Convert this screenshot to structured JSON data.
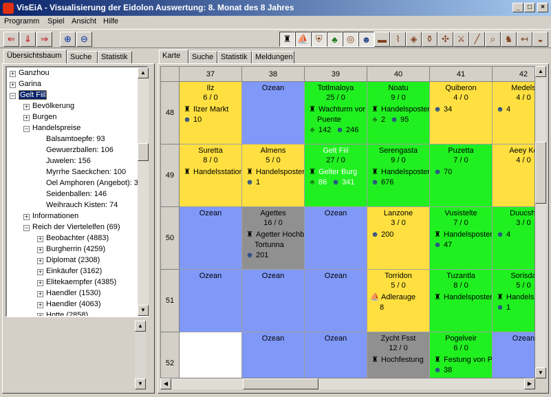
{
  "window": {
    "title": "VisEiA - Visualisierung der Eidolon Auswertung: 8. Monat des 8 Jahres",
    "minimize": "_",
    "maximize": "□",
    "close": "×"
  },
  "menu": [
    "Programm",
    "Spiel",
    "Ansicht",
    "Hilfe"
  ],
  "left_tabs": [
    "Übersichtsbaum",
    "Suche",
    "Statistik"
  ],
  "right_tabs": [
    "Karte",
    "Suche",
    "Statistik",
    "Meldungen"
  ],
  "tree": [
    {
      "label": "Ganzhou",
      "level": 0,
      "box": "+"
    },
    {
      "label": "Garina",
      "level": 0,
      "box": "+"
    },
    {
      "label": "Gelt Fiil",
      "level": 0,
      "box": "−",
      "selected": true
    },
    {
      "label": "Bevölkerung",
      "level": 1,
      "box": "+"
    },
    {
      "label": "Burgen",
      "level": 1,
      "box": "+"
    },
    {
      "label": "Handelspreise",
      "level": 1,
      "box": "−"
    },
    {
      "label": "Balsamtoepfe: 93",
      "level": 2,
      "box": ""
    },
    {
      "label": "Gewuerzballen: 106",
      "level": 2,
      "box": ""
    },
    {
      "label": "Juwelen: 156",
      "level": 2,
      "box": ""
    },
    {
      "label": "Myrrhe Saeckchen: 100",
      "level": 2,
      "box": ""
    },
    {
      "label": "Oel Amphoren (Angebot): 3",
      "level": 2,
      "box": ""
    },
    {
      "label": "Seidenballen: 146",
      "level": 2,
      "box": ""
    },
    {
      "label": "Weihrauch Kisten: 74",
      "level": 2,
      "box": ""
    },
    {
      "label": "Informationen",
      "level": 1,
      "box": "+"
    },
    {
      "label": "Reich der Viertelelfen (69)",
      "level": 1,
      "box": "−"
    },
    {
      "label": "Beobachter (4883)",
      "level": 2,
      "box": "+"
    },
    {
      "label": "Burgherrin (4259)",
      "level": 2,
      "box": "+"
    },
    {
      "label": "Diplomat (2308)",
      "level": 2,
      "box": "+"
    },
    {
      "label": "Einkäufer (3162)",
      "level": 2,
      "box": "+"
    },
    {
      "label": "Elitekaempfer (4385)",
      "level": 2,
      "box": "+"
    },
    {
      "label": "Haendler (1530)",
      "level": 2,
      "box": "+"
    },
    {
      "label": "Haendler (4063)",
      "level": 2,
      "box": "+"
    },
    {
      "label": "Hotte (2858)",
      "level": 2,
      "box": "+"
    }
  ],
  "columns": [
    "37",
    "38",
    "39",
    "40",
    "41",
    "42"
  ],
  "rows": [
    "48",
    "49",
    "50",
    "51",
    "52"
  ],
  "colors": {
    "yellow": "#ffe040",
    "blue": "#8098f8",
    "green": "#20f020",
    "gray": "#909090",
    "white": "#ffffff",
    "selection": "#0a246a"
  },
  "cells": [
    [
      {
        "color": "yellow",
        "name": "Ilz",
        "stat": "6 / 0",
        "lines": [
          {
            "icon": "castle-icon",
            "text": "Ilzer Markt"
          },
          {
            "icon": "people-icon",
            "text": "10"
          }
        ]
      },
      {
        "color": "blue",
        "name": "Ozean",
        "stat": "",
        "lines": []
      },
      {
        "color": "green",
        "name": "Totlmaloya",
        "stat": "25 / 0",
        "lines": [
          {
            "icon": "castle-icon",
            "text": "Wachturm vor"
          },
          {
            "icon": "",
            "text": "Puente"
          },
          {
            "icon": "tree-icon",
            "text": "142"
          },
          {
            "icon": "people-icon",
            "text": "246"
          }
        ]
      },
      {
        "color": "green",
        "name": "Noatu",
        "stat": "9 / 0",
        "lines": [
          {
            "icon": "castle-icon",
            "text": "Handelsposter"
          },
          {
            "icon": "tree-icon",
            "text": "2"
          },
          {
            "icon": "people-icon",
            "text": "95"
          }
        ]
      },
      {
        "color": "yellow",
        "name": "Quiberon",
        "stat": "4 / 0",
        "lines": [
          {
            "icon": "people-icon",
            "text": "34"
          }
        ]
      },
      {
        "color": "yellow",
        "name": "Medels",
        "stat": "4 / 0",
        "lines": [
          {
            "icon": "people-icon",
            "text": "4"
          }
        ]
      }
    ],
    [
      {
        "color": "yellow",
        "name": "Suretta",
        "stat": "8 / 0",
        "lines": [
          {
            "icon": "castle-icon",
            "text": "Handelsstation"
          }
        ]
      },
      {
        "color": "yellow",
        "name": "Almens",
        "stat": "5 / 0",
        "lines": [
          {
            "icon": "castle-icon",
            "text": "Handelsposter"
          },
          {
            "icon": "people-icon",
            "text": "1"
          }
        ]
      },
      {
        "color": "green",
        "name": "Gelt Fiil",
        "stat": "27 / 0",
        "lines": [
          {
            "icon": "castle-icon",
            "text": "Gelter Burg"
          },
          {
            "icon": "tree-icon",
            "text": "86"
          },
          {
            "icon": "people-icon",
            "text": "341"
          }
        ]
      },
      {
        "color": "green",
        "name": "Serengasta",
        "stat": "9 / 0",
        "lines": [
          {
            "icon": "castle-icon",
            "text": "Handelsposter"
          },
          {
            "icon": "people-icon",
            "text": "676"
          }
        ]
      },
      {
        "color": "green",
        "name": "Puzetta",
        "stat": "7 / 0",
        "lines": [
          {
            "icon": "people-icon",
            "text": "70"
          }
        ]
      },
      {
        "color": "yellow",
        "name": "Aeey Ko",
        "stat": "4 / 0",
        "lines": []
      }
    ],
    [
      {
        "color": "blue",
        "name": "Ozean",
        "stat": "",
        "lines": []
      },
      {
        "color": "gray",
        "name": "Agettes",
        "stat": "16 / 0",
        "lines": [
          {
            "icon": "castle-icon",
            "text": "Agetter Hochb"
          },
          {
            "icon": "",
            "text": "Tortunna"
          },
          {
            "icon": "people-icon",
            "text": "201"
          }
        ]
      },
      {
        "color": "blue",
        "name": "Ozean",
        "stat": "",
        "lines": []
      },
      {
        "color": "yellow",
        "name": "Lanzone",
        "stat": "3 / 0",
        "lines": [
          {
            "icon": "people-icon",
            "text": "200"
          }
        ]
      },
      {
        "color": "green",
        "name": "Vusistelte",
        "stat": "7 / 0",
        "lines": [
          {
            "icon": "castle-icon",
            "text": "Handelsposter"
          },
          {
            "icon": "people-icon",
            "text": "47"
          }
        ]
      },
      {
        "color": "green",
        "name": "Duucshi",
        "stat": "3 / 0",
        "lines": [
          {
            "icon": "people-icon",
            "text": "4"
          }
        ]
      }
    ],
    [
      {
        "color": "blue",
        "name": "Ozean",
        "stat": "",
        "lines": []
      },
      {
        "color": "blue",
        "name": "Ozean",
        "stat": "",
        "lines": []
      },
      {
        "color": "blue",
        "name": "Ozean",
        "stat": "",
        "lines": []
      },
      {
        "color": "yellow",
        "name": "Torridon",
        "stat": "5 / 0",
        "lines": [
          {
            "icon": "ship-icon",
            "text": "Adlerauge"
          },
          {
            "icon": "",
            "text": "8"
          }
        ]
      },
      {
        "color": "green",
        "name": "Tuzantla",
        "stat": "8 / 0",
        "lines": [
          {
            "icon": "castle-icon",
            "text": "Handelsposter"
          }
        ]
      },
      {
        "color": "green",
        "name": "Sorisda",
        "stat": "5 / 0",
        "lines": [
          {
            "icon": "castle-icon",
            "text": "Handels"
          },
          {
            "icon": "people-icon",
            "text": "1"
          }
        ]
      }
    ],
    [
      {
        "color": "white",
        "name": "",
        "stat": "",
        "lines": []
      },
      {
        "color": "blue",
        "name": "Ozean",
        "stat": "",
        "lines": []
      },
      {
        "color": "blue",
        "name": "Ozean",
        "stat": "",
        "lines": []
      },
      {
        "color": "gray",
        "name": "Zycht Fsst",
        "stat": "12 / 0",
        "lines": [
          {
            "icon": "castle-icon",
            "text": "Hochfestung"
          }
        ]
      },
      {
        "color": "green",
        "name": "Pogelveir",
        "stat": "6 / 0",
        "lines": [
          {
            "icon": "castle-icon",
            "text": "Festung von P"
          },
          {
            "icon": "people-icon",
            "text": "38"
          }
        ]
      },
      {
        "color": "blue",
        "name": "Ozean",
        "stat": "",
        "lines": []
      }
    ]
  ],
  "toolbar_left": [
    "open-left-icon",
    "open-down-icon",
    "open-right-icon",
    "zoom-in-icon",
    "zoom-out-icon"
  ],
  "toolbar_right": [
    "castle-icon",
    "ship-icon",
    "shield-icon",
    "tree-icon",
    "coins-icon",
    "people-icon",
    "eraser-icon",
    "scroll-icon",
    "cube-icon",
    "jar-icon",
    "cart-icon",
    "sword-icon",
    "staff-icon",
    "magnifier-icon",
    "horse-icon",
    "arrow-icon",
    "bowl-icon"
  ]
}
